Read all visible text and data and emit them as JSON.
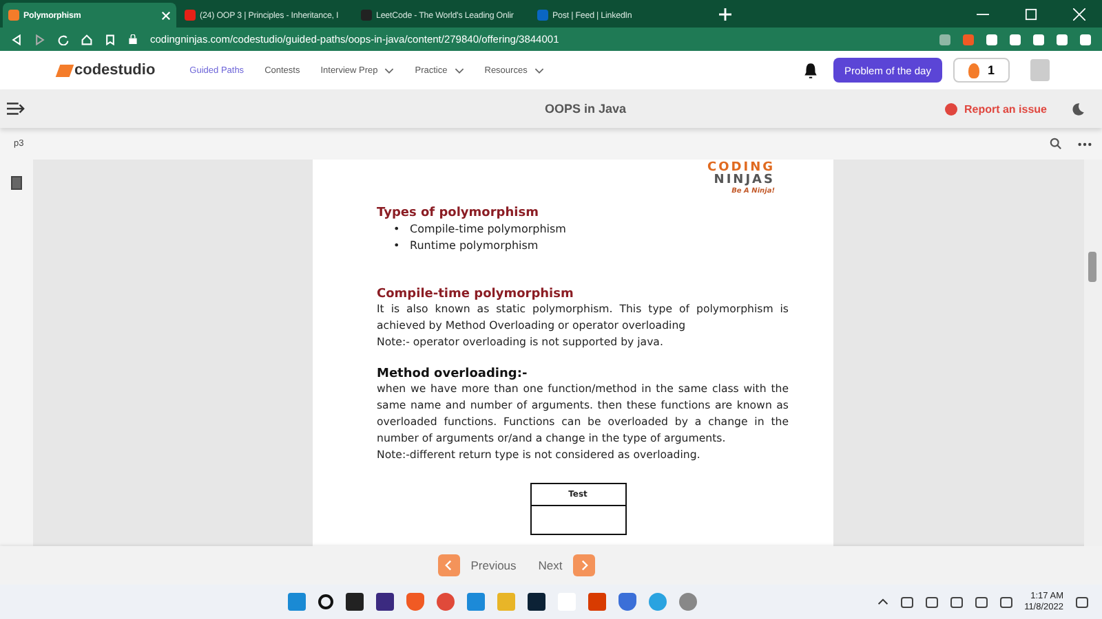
{
  "browser": {
    "tabs": [
      {
        "title": "Polymorphism",
        "selected": true
      },
      {
        "title": "(24) OOP 3 | Principles - Inheritance, I",
        "selected": false
      },
      {
        "title": "LeetCode - The World's Leading Onlir",
        "selected": false
      },
      {
        "title": "Post | Feed | LinkedIn",
        "selected": false
      }
    ],
    "address": "codingninjas.com/codestudio/guided-paths/oops-in-java/content/279840/offering/3844001"
  },
  "site_header": {
    "logo": "codestudio",
    "nav": [
      {
        "label": "Guided Paths",
        "selected": true,
        "dropdown": false
      },
      {
        "label": "Contests",
        "selected": false,
        "dropdown": false
      },
      {
        "label": "Interview Prep",
        "selected": false,
        "dropdown": true
      },
      {
        "label": "Practice",
        "selected": false,
        "dropdown": true
      },
      {
        "label": "Resources",
        "selected": false,
        "dropdown": true
      }
    ],
    "problem_button": "Problem of the day",
    "streak": "1"
  },
  "course_bar": {
    "title": "OOPS in Java",
    "report": "Report an issue"
  },
  "viewer_toolbar": {
    "page": "p3"
  },
  "document": {
    "logo": {
      "line1": "CODING",
      "line2": "NINJAS",
      "tagline": "Be A Ninja!"
    },
    "blocks": [
      {
        "kind": "heading",
        "text": "Types of polymorphism"
      },
      {
        "kind": "bullets",
        "marker": "•",
        "items": [
          "Compile-time polymorphism",
          "Runtime polymorphism"
        ]
      },
      {
        "kind": "heading",
        "text": "Compile-time polymorphism"
      },
      {
        "kind": "paragraph",
        "text": "It is also known as static polymorphism. This type of polymorphism is achieved by Method Overloading or operator overloading"
      },
      {
        "kind": "paragraph",
        "text": "Note:- operator overloading is not supported by java."
      },
      {
        "kind": "subheading",
        "text": "Method overloading:-"
      },
      {
        "kind": "paragraph",
        "text": "when we have more than one function/method in the same class with the same name and number of arguments. then these functions are known as overloaded functions. Functions can be overloaded by a change in the number of arguments or/and a change in the type of arguments."
      },
      {
        "kind": "paragraph",
        "text": "Note:-different return type is not considered as overloading."
      },
      {
        "kind": "diagram",
        "text": "Test"
      }
    ]
  },
  "pager": {
    "previous": "Previous",
    "next": "Next"
  },
  "taskbar": {
    "time": "1:17 AM",
    "date": "11/8/2022"
  }
}
